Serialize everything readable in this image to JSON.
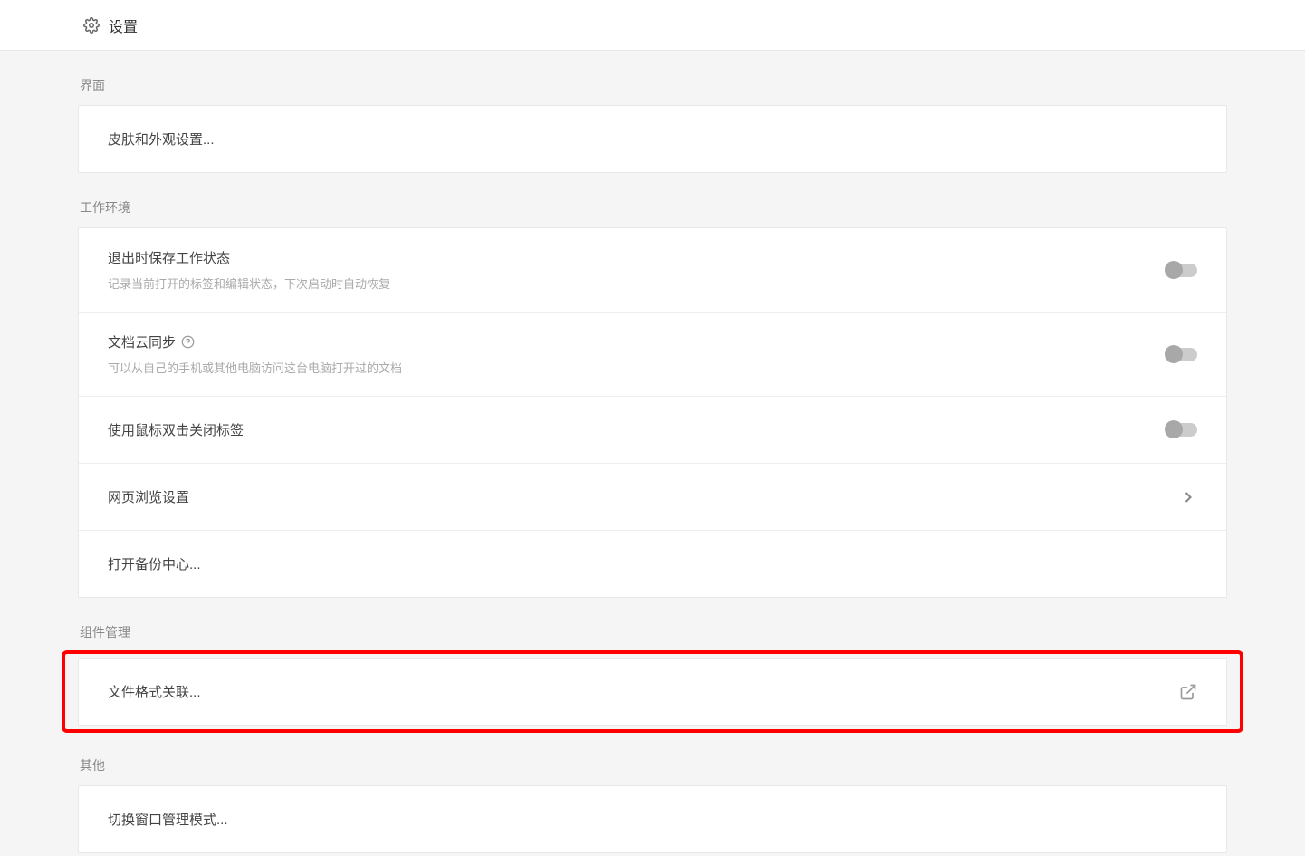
{
  "header": {
    "title": "设置"
  },
  "sections": {
    "interface": {
      "title": "界面",
      "skin_row": "皮肤和外观设置..."
    },
    "work_env": {
      "title": "工作环境",
      "save_state": {
        "title": "退出时保存工作状态",
        "desc": "记录当前打开的标签和编辑状态，下次启动时自动恢复"
      },
      "cloud_sync": {
        "title": "文档云同步",
        "desc": "可以从自己的手机或其他电脑访问这台电脑打开过的文档"
      },
      "double_click_close": "使用鼠标双击关闭标签",
      "web_browse": "网页浏览设置",
      "backup_center": "打开备份中心..."
    },
    "component_mgmt": {
      "title": "组件管理",
      "file_format": "文件格式关联..."
    },
    "other": {
      "title": "其他",
      "window_mode": "切换窗口管理模式..."
    }
  }
}
